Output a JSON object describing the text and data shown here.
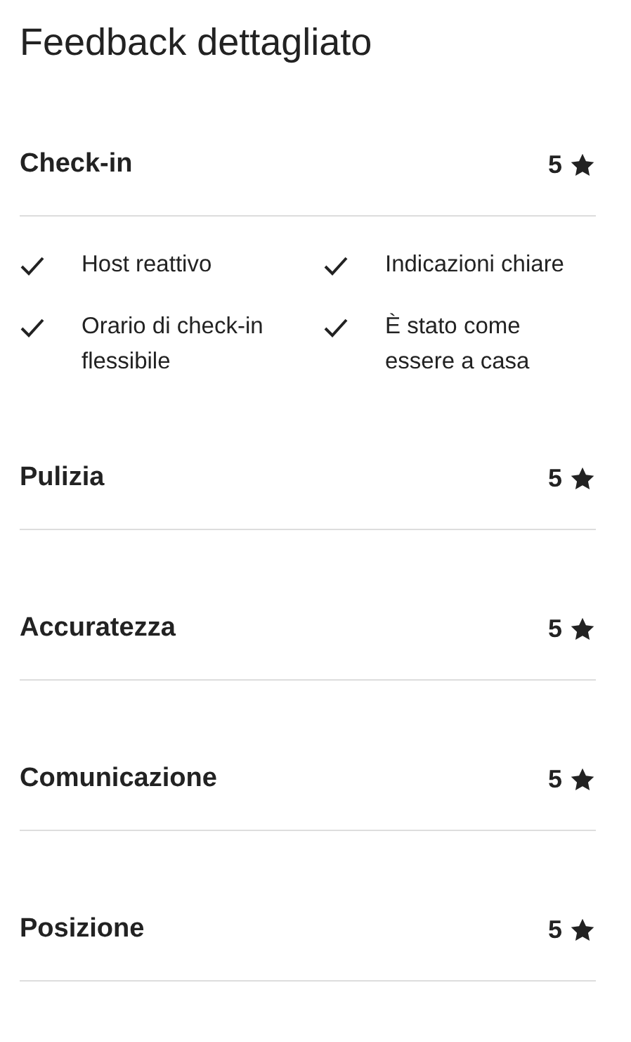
{
  "title": "Feedback dettagliato",
  "categories": [
    {
      "name": "Check-in",
      "rating": "5",
      "highlights": [
        "Host reattivo",
        "Indicazioni chiare",
        "Orario di check-in flessibile",
        "È stato come essere a casa"
      ]
    },
    {
      "name": "Pulizia",
      "rating": "5"
    },
    {
      "name": "Accuratezza",
      "rating": "5"
    },
    {
      "name": "Comunicazione",
      "rating": "5"
    },
    {
      "name": "Posizione",
      "rating": "5"
    }
  ]
}
